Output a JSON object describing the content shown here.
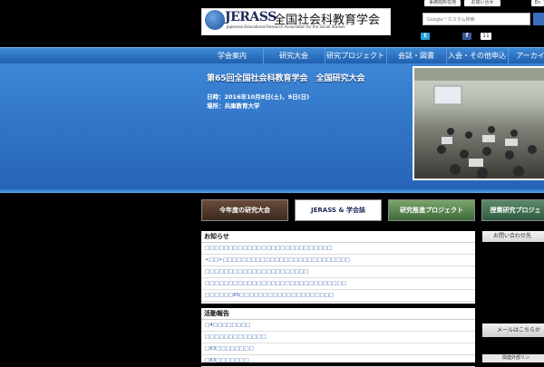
{
  "header": {
    "logo_text": "JERASS",
    "logo_name_jp": "全国社会科教育学会",
    "logo_subtitle": "Japanese Educational Research Association for the Social Studies",
    "top_links": [
      "事務局所在地",
      "お問い合せ",
      "En"
    ],
    "search_placeholder": "Google™カスタム検索",
    "social": {
      "twitter": "t",
      "facebook": "f",
      "count": "11"
    }
  },
  "nav": {
    "items": [
      "学会案内",
      "研究大会",
      "研究プロジェクト",
      "会誌・図書",
      "入会・その他申込",
      "アーカイ"
    ]
  },
  "hero": {
    "title": "第65回全国社会科教育学会　全国研究大会",
    "date": "日時：2016年10月8日(土)、9日(日)",
    "place": "場所：兵庫教育大学"
  },
  "banners": [
    "今年度の研究大会",
    "JERASS & 学会誌",
    "研究推進プロジェクト",
    "授業研究プロジェ"
  ],
  "news": {
    "heading": "お知らせ",
    "items": [
      "□□□□□□□□□□□□□□□□□□□□□□□□□□□",
      "<□□>□□□□□□□□□□□□□□□□□□□□□□□□□□□",
      "□□□□□□□□□□□□□□□□□□□□□□",
      "□□□□□□□□□□□□□□□□□□□□□□□□□□□□□□",
      "□□□□□□65□□□□□□□□□□□□□□□□□□□□"
    ]
  },
  "activity": {
    "heading": "活動報告",
    "items": [
      "□4□□□□□□□□",
      "□□□□□□□□□□□□□",
      "□63□□□□□□□□",
      "□63□□□□□□□"
    ]
  },
  "sidebar": {
    "contact_heading": "お問い合わせ先",
    "mail_button": "メールはこちらか",
    "links_heading": "関連外部リン"
  }
}
